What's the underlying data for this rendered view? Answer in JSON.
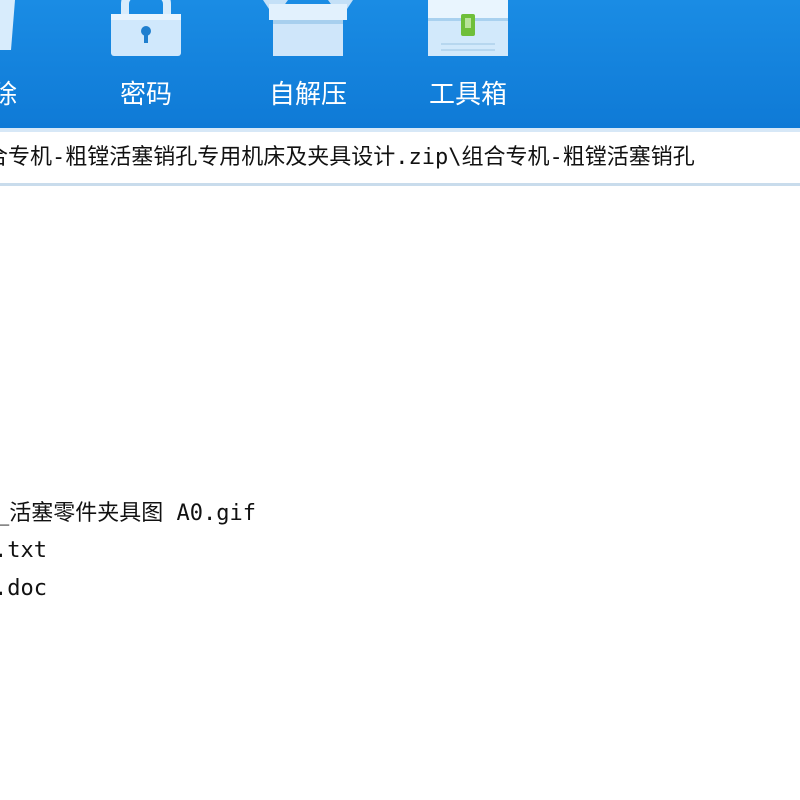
{
  "toolbar": {
    "buttons": [
      {
        "id": "delete",
        "label": "除",
        "icon": "delete-icon"
      },
      {
        "id": "password",
        "label": "密码",
        "icon": "lock-icon"
      },
      {
        "id": "extract",
        "label": "自解压",
        "icon": "box-icon"
      },
      {
        "id": "toolbox",
        "label": "工具箱",
        "icon": "toolbox-icon"
      }
    ],
    "colors": {
      "background": "#1583dd",
      "icon": "#cfe7fb",
      "label": "#ffffff"
    }
  },
  "path": {
    "text": "合专机-粗镗活塞销孔专用机床及夹具设计.zip\\组合专机-粗镗活塞销孔"
  },
  "files": [
    {
      "name": "_活塞零件夹具图 A0.gif"
    },
    {
      "name": ".txt"
    },
    {
      "name": ".doc"
    }
  ]
}
